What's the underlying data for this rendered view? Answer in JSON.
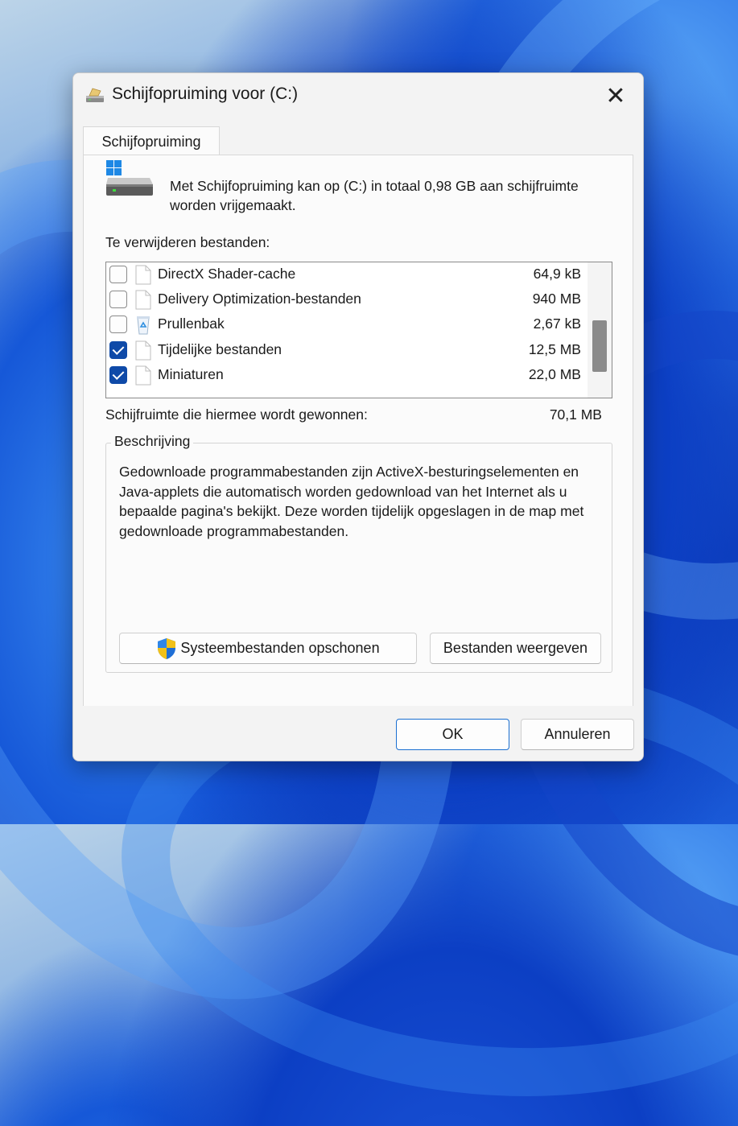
{
  "window": {
    "title": "Schijfopruiming voor  (C:)"
  },
  "tabs": [
    {
      "label": "Schijfopruiming"
    }
  ],
  "intro_text": "Met Schijfopruiming kan op  (C:) in totaal 0,98 GB aan schijfruimte worden vrijgemaakt.",
  "files_label": "Te verwijderen bestanden:",
  "files": [
    {
      "name": "DirectX Shader-cache",
      "size": "64,9 kB",
      "checked": false,
      "icon": "file-icon"
    },
    {
      "name": "Delivery Optimization-bestanden",
      "size": "940 MB",
      "checked": false,
      "icon": "file-icon"
    },
    {
      "name": "Prullenbak",
      "size": "2,67 kB",
      "checked": false,
      "icon": "recycle-bin-icon"
    },
    {
      "name": "Tijdelijke bestanden",
      "size": "12,5 MB",
      "checked": true,
      "icon": "file-icon"
    },
    {
      "name": "Miniaturen",
      "size": "22,0 MB",
      "checked": true,
      "icon": "file-icon"
    }
  ],
  "gain": {
    "label": "Schijfruimte die hiermee wordt gewonnen:",
    "value": "70,1 MB"
  },
  "description": {
    "legend": "Beschrijving",
    "text": "Gedownloade programmabestanden zijn ActiveX-besturingselementen en Java-applets die automatisch worden gedownload van het Internet als u bepaalde pagina's bekijkt. Deze worden tijdelijk opgeslagen in de map met gedownloade programmabestanden."
  },
  "buttons": {
    "system_cleanup": "Systeembestanden opschonen",
    "view_files": "Bestanden weergeven",
    "ok": "OK",
    "cancel": "Annuleren"
  },
  "colors": {
    "checkbox_checked": "#0f4aa8",
    "ok_border": "#1a6fd1",
    "dialog_bg": "#f3f3f3"
  }
}
